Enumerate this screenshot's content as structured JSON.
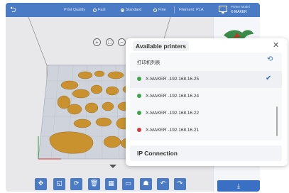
{
  "topbar": {
    "quality_label": "Print Quality",
    "quality_options": [
      "Fast",
      "Standard",
      "Fine"
    ],
    "quality_selected": "Standard",
    "filament": "Filament: PLA",
    "printer_model_label": "Printer Model",
    "printer_model": "X-MAKER"
  },
  "dialog": {
    "title": "Available printers",
    "list_header": "打印机列表",
    "printers": [
      {
        "name": "X-MAKER -192.168.16.25",
        "status": "online",
        "selected": true
      },
      {
        "name": "X-MAKER -192.168.16.24",
        "status": "online",
        "selected": false
      },
      {
        "name": "X-MAKER -192.168.16.22",
        "status": "online",
        "selected": false
      },
      {
        "name": "X-MAKER -192.168.16.21",
        "status": "offline",
        "selected": false
      }
    ],
    "ip_connection": "IP Connection"
  },
  "colors": {
    "accent": "#4a7bc4",
    "online": "#3aa84a",
    "offline": "#d63b3b",
    "model": "#c9922e"
  },
  "icons": {
    "back": "back-arrow-icon",
    "close": "close-icon",
    "refresh": "refresh-icon",
    "check": "check-icon",
    "toolbar": [
      "move-icon",
      "scale-icon",
      "rotate-icon",
      "delete-icon",
      "layout-icon",
      "image-icon",
      "person-icon",
      "undo-icon",
      "redo-icon"
    ]
  }
}
